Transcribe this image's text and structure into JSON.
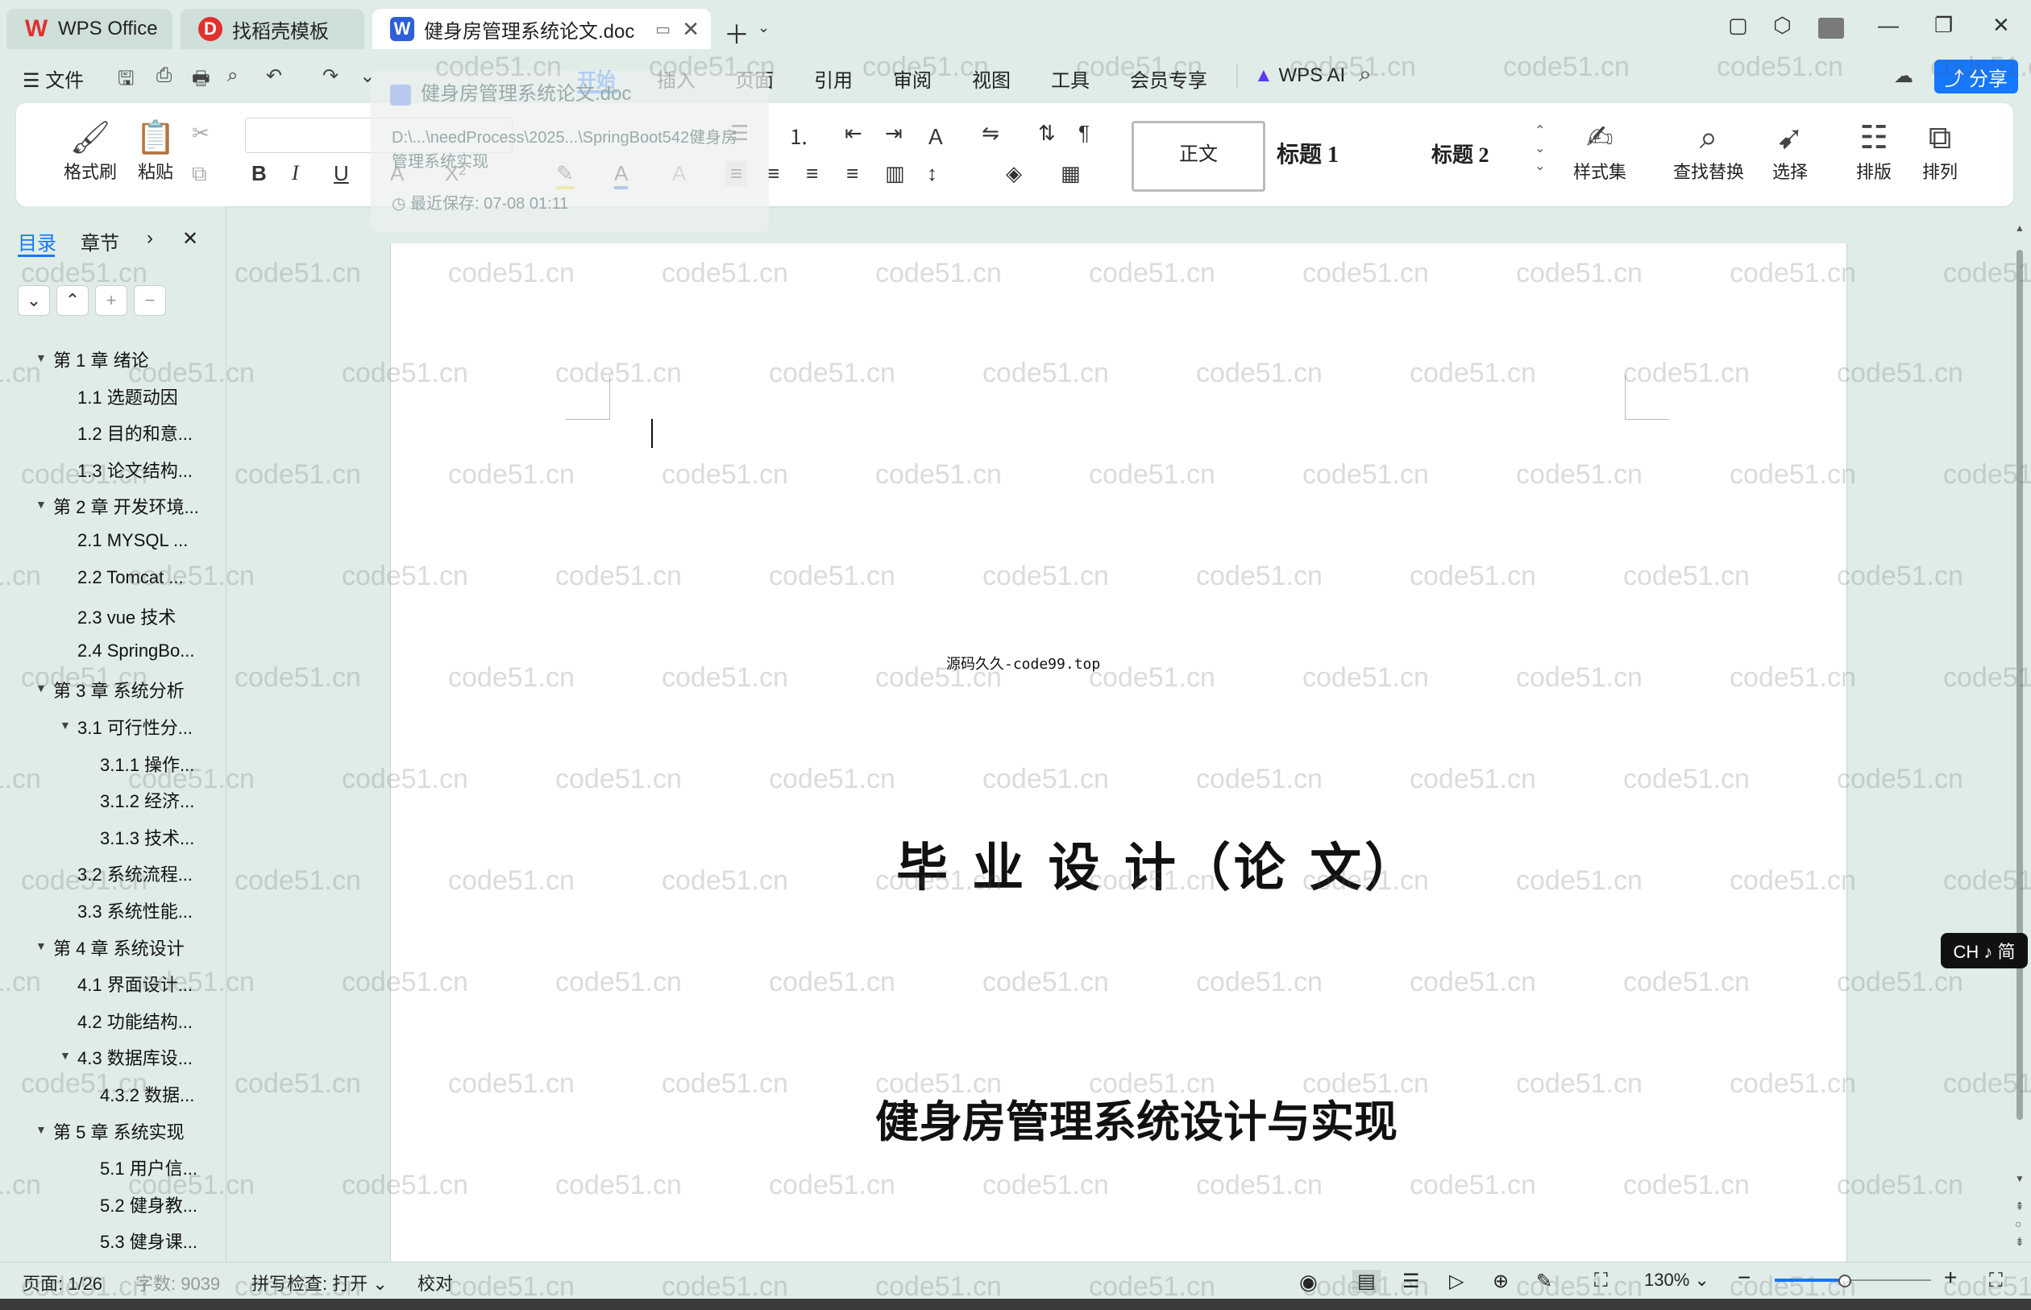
{
  "tabs": [
    {
      "label": "WPS Office",
      "icon": "wps-logo-icon"
    },
    {
      "label": "找稻壳模板",
      "icon": "docer-icon"
    },
    {
      "label": "健身房管理系统论文.doc",
      "icon": "word-doc-icon"
    }
  ],
  "menu": {
    "file": "文件",
    "items": [
      "开始",
      "插入",
      "页面",
      "引用",
      "审阅",
      "视图",
      "工具",
      "会员专享"
    ],
    "wps_ai": "WPS AI",
    "share": "分享"
  },
  "ribbon": {
    "format_painter": "格式刷",
    "paste": "粘贴",
    "styles": [
      "正文",
      "标题 1",
      "标题 2"
    ],
    "style_set": "样式集",
    "find_replace": "查找替换",
    "select": "选择",
    "layout": "排版",
    "arrange": "排列"
  },
  "ghost_tooltip": {
    "title": "健身房管理系统论文.doc",
    "path": "D:\\...\\needProcess\\2025...\\SpringBoot542健身房管理系统实现",
    "saved": "最近保存: 07-08 01:11"
  },
  "sidebar": {
    "tab_toc": "目录",
    "tab_chapter": "章节",
    "items": [
      {
        "label": "第 1 章  绪论",
        "level": 1,
        "expanded": true
      },
      {
        "label": "1.1 选题动因",
        "level": 2
      },
      {
        "label": "1.2 目的和意...",
        "level": 2
      },
      {
        "label": "1.3 论文结构...",
        "level": 2
      },
      {
        "label": "第 2 章  开发环境...",
        "level": 1,
        "expanded": true
      },
      {
        "label": "2.1 MYSQL ...",
        "level": 2
      },
      {
        "label": "2.2 Tomcat ...",
        "level": 2
      },
      {
        "label": "2.3 vue 技术",
        "level": 2
      },
      {
        "label": "2.4 SpringBo...",
        "level": 2
      },
      {
        "label": "第 3 章  系统分析",
        "level": 1,
        "expanded": true
      },
      {
        "label": "3.1 可行性分...",
        "level": 2,
        "expanded": true
      },
      {
        "label": "3.1.1 操作...",
        "level": 3
      },
      {
        "label": "3.1.2 经济...",
        "level": 3
      },
      {
        "label": "3.1.3 技术...",
        "level": 3
      },
      {
        "label": "3.2 系统流程...",
        "level": 2
      },
      {
        "label": "3.3 系统性能...",
        "level": 2
      },
      {
        "label": "第 4 章  系统设计",
        "level": 1,
        "expanded": true
      },
      {
        "label": "4.1 界面设计...",
        "level": 2
      },
      {
        "label": "4.2 功能结构...",
        "level": 2
      },
      {
        "label": "4.3 数据库设...",
        "level": 2,
        "expanded": true
      },
      {
        "label": "4.3.2  数据...",
        "level": 3
      },
      {
        "label": "第 5 章  系统实现",
        "level": 1,
        "expanded": true
      },
      {
        "label": "5.1 用户信...",
        "level": 3
      },
      {
        "label": "5.2  健身教...",
        "level": 3
      },
      {
        "label": "5.3 健身课...",
        "level": 3
      }
    ]
  },
  "document": {
    "source_line": "源码久久-code99.top",
    "title": "毕 业 设 计（论 文）",
    "subtitle": "健身房管理系统设计与实现"
  },
  "status": {
    "page": "页面: 1/26",
    "words": "字数: 9039",
    "spell": "拼写检查: 打开",
    "proof": "校对",
    "zoom": "130%",
    "zoom_level": 0.45
  },
  "ime_badge": "CH ♪ 简",
  "watermark": "code51.cn",
  "colors": {
    "accent": "#1677ff",
    "wps_red": "#e0312f",
    "background": "#dfece8"
  }
}
